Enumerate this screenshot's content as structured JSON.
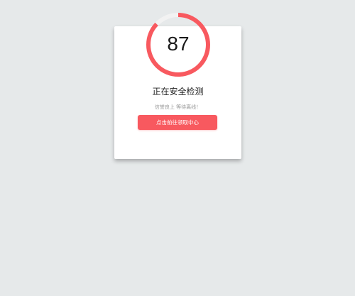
{
  "security_check": {
    "score": "87",
    "progress_fraction": 0.87,
    "title": "正在安全检测",
    "subtitle": "信誉良上 等待离线！",
    "button_label": "点击前往领取中心"
  },
  "colors": {
    "background": "#e6e9ea",
    "card": "#ffffff",
    "accent": "#f8595f",
    "track": "#f2f2f2"
  }
}
